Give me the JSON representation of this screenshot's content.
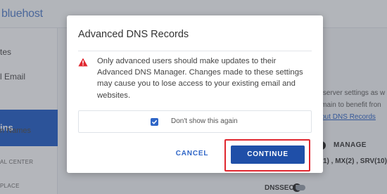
{
  "background": {
    "logo": "bluehost",
    "sidebar": {
      "item_1": "tes",
      "item_2": "l Email",
      "active_item": "ins",
      "item_4": "n Names",
      "item_5": "AL CENTER",
      "item_6": "PLACE"
    },
    "content": {
      "line_1": "meserver settings as w",
      "line_2": "domain to benefit fron",
      "link": "about DNS Records",
      "manage_label": "MANAGE",
      "records_text": "1) , MX(2) , SRV(10) ,",
      "dnssec_label": "DNSSEC",
      "dnssec_icon_glyph": "?",
      "manage_icon_glyph": "?"
    }
  },
  "modal": {
    "title": "Advanced DNS Records",
    "warning_icon": "warning-triangle-icon",
    "warning_color": "#e0262e",
    "message": "Only advanced users should make updates to their Advanced DNS Manager. Changes made to these settings may cause you to lose access to your existing email and websites.",
    "checkbox": {
      "label": "Don't show this again",
      "checked": true
    },
    "cancel_label": "CANCEL",
    "continue_label": "CONTINUE",
    "accent_color": "#2f66c7",
    "primary_button_color": "#1f4fa8",
    "highlight_color": "#e0262e"
  }
}
